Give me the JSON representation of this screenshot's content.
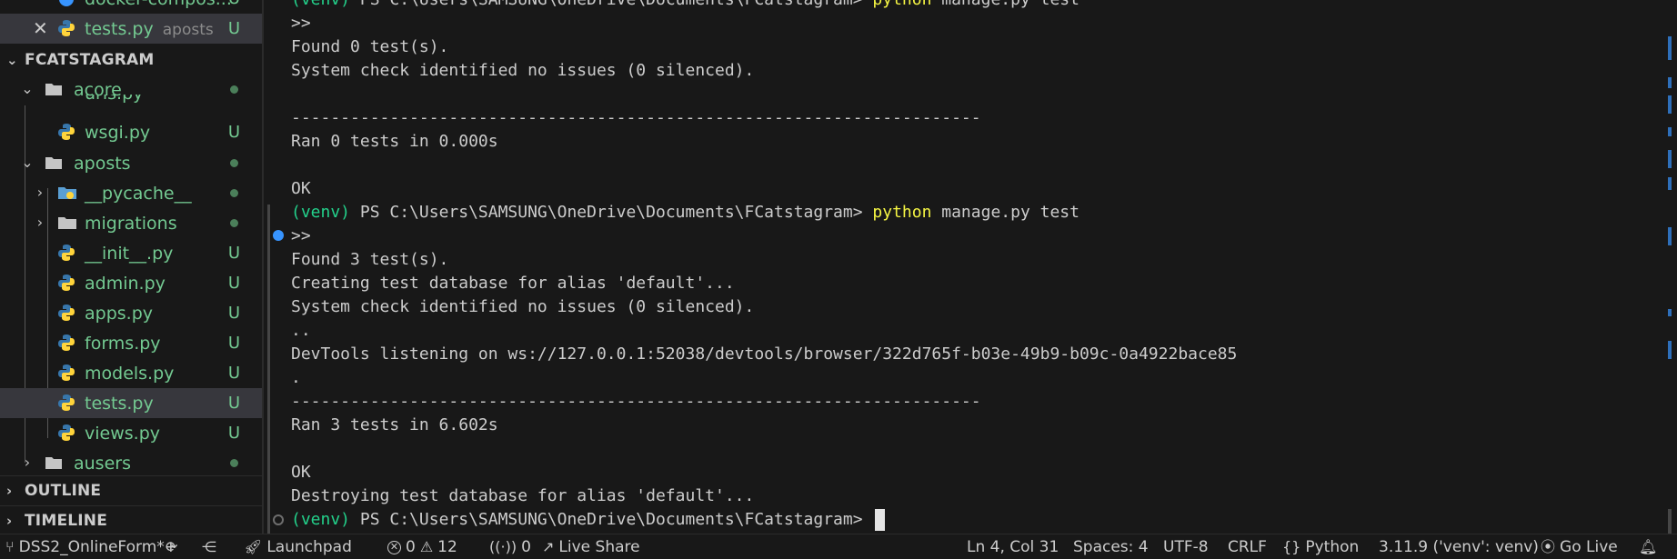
{
  "sidebar": {
    "top_items": [
      {
        "label": "docker-compos...",
        "status": "U"
      },
      {
        "label": "tests.py",
        "desc": "aposts",
        "status": "U"
      }
    ],
    "project": {
      "title": "FCATSTAGRAM"
    },
    "tree": [
      {
        "label": "acore",
        "type": "folder",
        "expanded": true
      },
      {
        "label": "urls.py",
        "type": "python",
        "status": "U"
      },
      {
        "label": "wsgi.py",
        "type": "python",
        "status": "U"
      },
      {
        "label": "aposts",
        "type": "folder",
        "expanded": true
      },
      {
        "label": "__pycache__",
        "type": "folder",
        "expanded": false
      },
      {
        "label": "migrations",
        "type": "folder",
        "expanded": false
      },
      {
        "label": "__init__.py",
        "type": "python",
        "status": "U"
      },
      {
        "label": "admin.py",
        "type": "python",
        "status": "U"
      },
      {
        "label": "apps.py",
        "type": "python",
        "status": "U"
      },
      {
        "label": "forms.py",
        "type": "python",
        "status": "U"
      },
      {
        "label": "models.py",
        "type": "python",
        "status": "U"
      },
      {
        "label": "tests.py",
        "type": "python",
        "status": "U",
        "selected": true
      },
      {
        "label": "views.py",
        "type": "python",
        "status": "U"
      },
      {
        "label": "ausers",
        "type": "folder",
        "expanded": false
      }
    ],
    "sections": [
      {
        "title": "OUTLINE"
      },
      {
        "title": "TIMELINE"
      }
    ]
  },
  "terminal": {
    "prompt_venv": "(venv)",
    "prompt_path": " PS C:\\Users\\SAMSUNG\\OneDrive\\Documents\\FCatstagram> ",
    "cmd_python": "python",
    "cmd_rest": " manage.py test",
    "lines": [
      ">>",
      "Found 0 test(s).",
      "System check identified no issues (0 silenced).",
      "",
      "----------------------------------------------------------------------",
      "Ran 0 tests in 0.000s",
      "",
      "OK",
      "PROMPT_CMD",
      ">>",
      "Found 3 test(s).",
      "Creating test database for alias 'default'...",
      "System check identified no issues (0 silenced).",
      "..",
      "DevTools listening on ws://127.0.0.1:52038/devtools/browser/322d765f-b03e-49b9-b09c-0a4922bace85",
      ".",
      "----------------------------------------------------------------------",
      "Ran 3 tests in 6.602s",
      "",
      "OK",
      "Destroying test database for alias 'default'...",
      "PROMPT_CURSOR"
    ]
  },
  "statusbar": {
    "branch": "DSS2_OnlineForm*+",
    "launchpad": "Launchpad",
    "errors": "0",
    "warnings": "12",
    "ports": "0",
    "live_share": "Live Share",
    "position": "Ln 4, Col 31",
    "spaces": "Spaces: 4",
    "encoding": "UTF-8",
    "eol": "CRLF",
    "language": "Python",
    "interpreter": "3.11.9 ('venv': venv)",
    "go_live": "Go Live"
  },
  "colors": {
    "background": "#181818",
    "untracked": "#73c991",
    "prompt_venv": "#23d18b",
    "command": "#f5f543",
    "accent": "#3794ff"
  },
  "icons": [
    "close-icon",
    "python-file-icon",
    "folder-icon",
    "chevron-down-icon",
    "chevron-right-icon",
    "sync-icon",
    "source-control-icon",
    "rocket-icon",
    "error-icon",
    "warning-icon",
    "broadcast-icon",
    "live-share-icon",
    "braces-icon",
    "go-live-icon",
    "bell-icon"
  ]
}
